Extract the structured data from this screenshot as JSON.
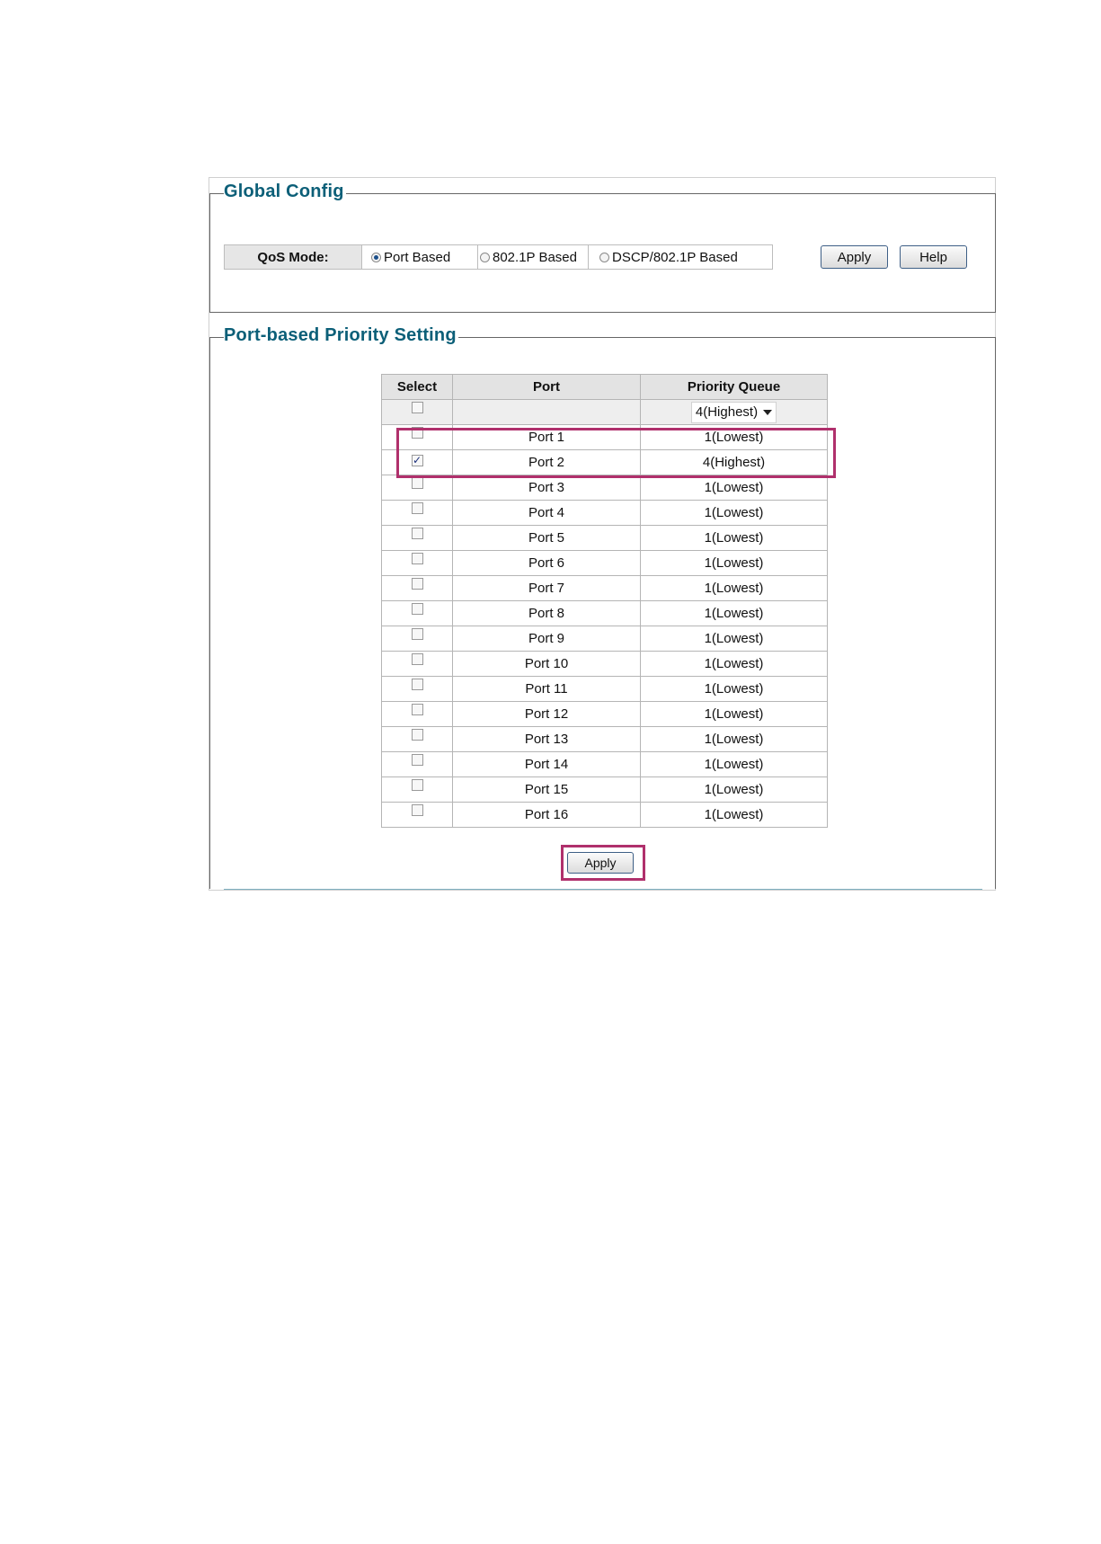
{
  "global_config": {
    "title": "Global Config",
    "qos_mode_label": "QoS Mode:",
    "options": [
      {
        "label": "Port Based",
        "selected": true
      },
      {
        "label": "802.1P Based",
        "selected": false
      },
      {
        "label": "DSCP/802.1P Based",
        "selected": false
      }
    ],
    "apply_label": "Apply",
    "help_label": "Help"
  },
  "port_priority": {
    "title": "Port-based Priority Setting",
    "headers": {
      "select": "Select",
      "port": "Port",
      "priority_queue": "Priority Queue"
    },
    "selected_queue": "4(Highest)",
    "rows": [
      {
        "port": "Port 1",
        "queue": "1(Lowest)",
        "checked": false
      },
      {
        "port": "Port 2",
        "queue": "4(Highest)",
        "checked": true
      },
      {
        "port": "Port 3",
        "queue": "1(Lowest)",
        "checked": false
      },
      {
        "port": "Port 4",
        "queue": "1(Lowest)",
        "checked": false
      },
      {
        "port": "Port 5",
        "queue": "1(Lowest)",
        "checked": false
      },
      {
        "port": "Port 6",
        "queue": "1(Lowest)",
        "checked": false
      },
      {
        "port": "Port 7",
        "queue": "1(Lowest)",
        "checked": false
      },
      {
        "port": "Port 8",
        "queue": "1(Lowest)",
        "checked": false
      },
      {
        "port": "Port 9",
        "queue": "1(Lowest)",
        "checked": false
      },
      {
        "port": "Port 10",
        "queue": "1(Lowest)",
        "checked": false
      },
      {
        "port": "Port 11",
        "queue": "1(Lowest)",
        "checked": false
      },
      {
        "port": "Port 12",
        "queue": "1(Lowest)",
        "checked": false
      },
      {
        "port": "Port 13",
        "queue": "1(Lowest)",
        "checked": false
      },
      {
        "port": "Port 14",
        "queue": "1(Lowest)",
        "checked": false
      },
      {
        "port": "Port 15",
        "queue": "1(Lowest)",
        "checked": false
      },
      {
        "port": "Port 16",
        "queue": "1(Lowest)",
        "checked": false
      }
    ],
    "apply_label": "Apply"
  },
  "colors": {
    "section_title": "#0c5f78",
    "highlight": "#b0306c"
  }
}
